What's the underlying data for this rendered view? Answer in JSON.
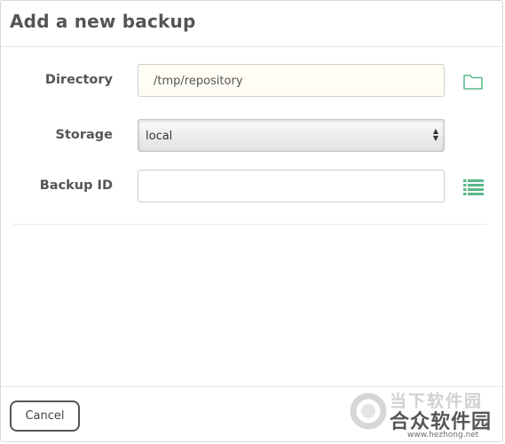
{
  "dialog": {
    "title": "Add a new backup"
  },
  "form": {
    "directory": {
      "label": "Directory",
      "value": "/tmp/repository"
    },
    "storage": {
      "label": "Storage",
      "value": "local"
    },
    "backup_id": {
      "label": "Backup ID",
      "value": ""
    }
  },
  "icons": {
    "folder": "folder-icon",
    "list": "list-icon",
    "select_arrows": "select-arrows-icon"
  },
  "footer": {
    "cancel_label": "Cancel"
  },
  "watermark": {
    "line1": "当下软件园",
    "line2": "合众软件园",
    "url": "www.hezhong.net"
  },
  "colors": {
    "accent_green": "#5cb88a",
    "text": "#555555"
  }
}
